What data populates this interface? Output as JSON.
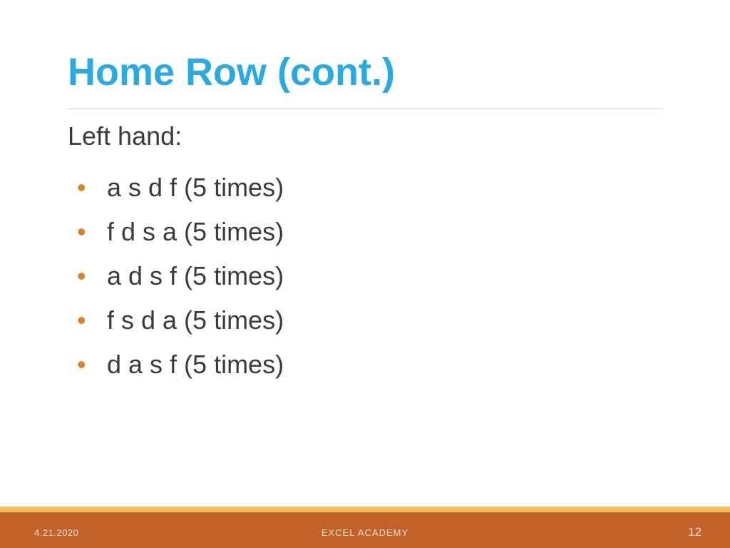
{
  "title": "Home Row (cont.)",
  "subheading": "Left hand:",
  "bullets": [
    "a s d f  (5 times)",
    "f d s a  (5 times)",
    "a d s f  (5 times)",
    "f s d a  (5 times)",
    "d a s f  (5 times)"
  ],
  "footer": {
    "date": "4.21.2020",
    "center": "EXCEL ACADEMY",
    "page": "12"
  }
}
